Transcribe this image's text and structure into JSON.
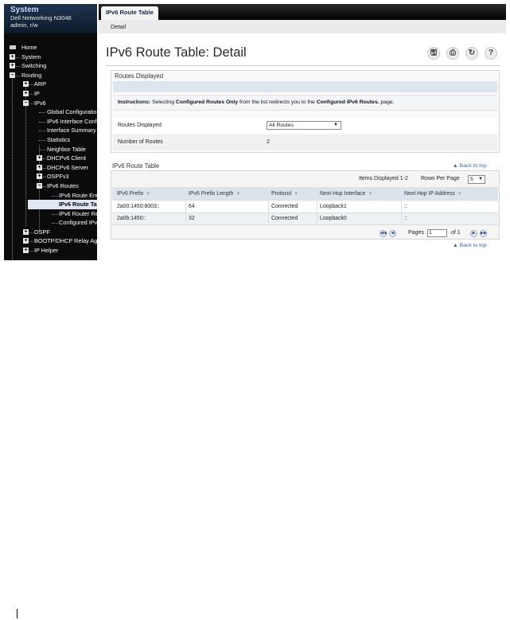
{
  "sidebar": {
    "title": "System",
    "device": "Dell Networking N3048",
    "user": "admin, r/w",
    "items": [
      {
        "label": "Home"
      },
      {
        "label": "System"
      },
      {
        "label": "Switching"
      },
      {
        "label": "Routing"
      },
      {
        "label": "ARP"
      },
      {
        "label": "IP"
      },
      {
        "label": "IPv6"
      },
      {
        "label": "Global Configuratio"
      },
      {
        "label": "IPv6 Interface Confi"
      },
      {
        "label": "Interface Summary"
      },
      {
        "label": "Statistics"
      },
      {
        "label": "Neighbor Table"
      },
      {
        "label": "DHCPv6 Client"
      },
      {
        "label": "DHCPv6 Server"
      },
      {
        "label": "OSPFv3"
      },
      {
        "label": "IPv6 Routes"
      },
      {
        "label": "IPv6 Route Entr"
      },
      {
        "label": "IPv6 Route Ta"
      },
      {
        "label": "IPv6 Router Re"
      },
      {
        "label": "Configured IPv"
      },
      {
        "label": "OSPF"
      },
      {
        "label": "BOOTP/DHCP Relay Ag"
      },
      {
        "label": "IP Helper"
      }
    ]
  },
  "tabs": {
    "active": "IPv6 Route Table",
    "sub": "Detail"
  },
  "page": {
    "title": "IPv6 Route Table: Detail",
    "toolbar_icons": [
      "save-icon",
      "print-icon",
      "refresh-icon",
      "help-icon"
    ]
  },
  "routes_displayed": {
    "title": "Routes Displayed",
    "instructions_prefix": "Instructions: ",
    "instructions_1": "Selecting ",
    "instructions_2": "Configured Routes Only",
    "instructions_3": " from the list redirects you to the ",
    "instructions_4": "Configured IPv6 Routes.",
    "instructions_5": " page.",
    "routes_displayed_label": "Routes Displayed",
    "routes_displayed_value": "All Routes",
    "number_of_routes_label": "Number of Routes",
    "number_of_routes_value": "2"
  },
  "route_table": {
    "title": "IPv6 Route Table",
    "back_to_top": "▲ Back to top",
    "items_displayed": "Items Displayed 1-2",
    "rows_per_page_label": "Rows Per Page",
    "rows_per_page_value": "5",
    "columns": [
      "IPv6 Prefix",
      "IPv6 Prefix Length",
      "Protocol",
      "Next Hop Interface",
      "Next Hop IP Address"
    ],
    "rows": [
      {
        "prefix": "2a00:1450:8003::",
        "length": "64",
        "protocol": "Connected",
        "interface": "Loopback1",
        "nexthop": "::"
      },
      {
        "prefix": "2a0b:1450::",
        "length": "32",
        "protocol": "Connected",
        "interface": "Loopback0",
        "nexthop": "::"
      }
    ],
    "pages_label": "Pages",
    "page_value": "1",
    "of_label": "of 1"
  },
  "bottom_back_to_top": "▲ Back to top"
}
